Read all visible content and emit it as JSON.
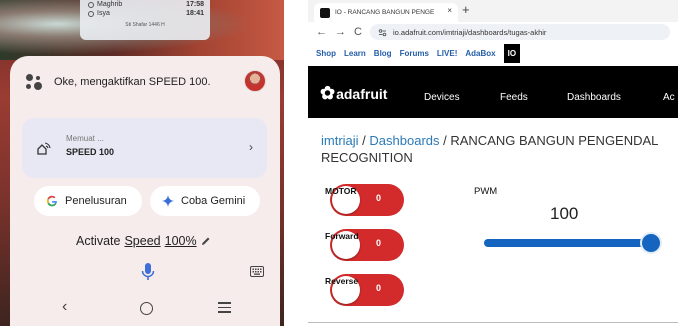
{
  "phone": {
    "prayer": {
      "rows": [
        {
          "name": "Maghrib",
          "time": "17:58"
        },
        {
          "name": "Isya",
          "time": "18:41"
        }
      ],
      "footer": "Sti Shafar 1446 H"
    },
    "assistant_text": "Oke, mengaktifkan SPEED 100.",
    "card": {
      "line1": "Memuat ...",
      "line2": "SPEED 100",
      "chevron": "›"
    },
    "pill_search": "Penelusuran",
    "pill_gemini": "Coba Gemini",
    "activate": {
      "word1": "Activate",
      "word2": "Speed",
      "word3": "100%"
    },
    "nav": {
      "back": "‹"
    }
  },
  "browser": {
    "tab_title": "IO - RANCANG BANGUN PENGE",
    "tab_close": "×",
    "new_tab": "+",
    "nav_back": "←",
    "nav_forward": "→",
    "nav_reload": "C",
    "url": "io.adafruit.com/imtriaji/dashboards/tugas-akhir",
    "menu": [
      "Shop",
      "Learn",
      "Blog",
      "Forums",
      "LIVE!",
      "AdaBox"
    ],
    "menu_active": "IO",
    "logo_text": "adafruit",
    "header_nav": [
      "Devices",
      "Feeds",
      "Dashboards",
      "Ac"
    ],
    "breadcrumb": {
      "user": "imtriaji",
      "sep1": " / ",
      "dash": "Dashboards",
      "sep2": " / ",
      "name": "RANCANG BANGUN PENGENDAL",
      "name2": "RECOGNITION"
    },
    "toggles": [
      {
        "label": "MOTOR",
        "value": "0"
      },
      {
        "label": "Forward",
        "value": "0"
      },
      {
        "label": "Reverse",
        "value": "0"
      }
    ],
    "pwm": {
      "label": "PWM",
      "value": "100",
      "fraction": 1.0
    },
    "colors": {
      "toggle_red": "#d32b2b",
      "slider_blue": "#1565c0"
    }
  }
}
